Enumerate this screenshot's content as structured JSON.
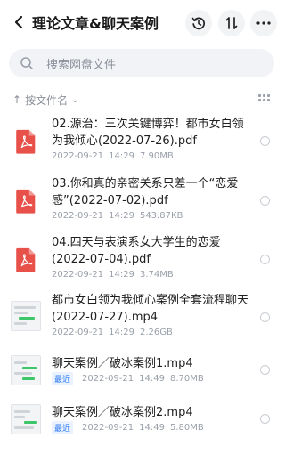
{
  "header": {
    "title": "理论文章&聊天案例",
    "back_icon": "chevron-left-icon",
    "history_icon": "history-icon",
    "sort_icon": "sort-arrows-icon",
    "more_icon": "more-horizontal-icon"
  },
  "search": {
    "placeholder": "搜索网盘文件",
    "icon": "search-icon"
  },
  "sort": {
    "label": "按文件名",
    "arrow": "↑",
    "chevron": "⌄"
  },
  "files": [
    {
      "name": "02.源治：三次关键博弈！都市女白领为我倾心(2022-07-26).pdf",
      "date": "2022-09-21",
      "time": "14:29",
      "size": "7.90MB",
      "type": "pdf"
    },
    {
      "name": "03.你和真的亲密关系只差一个“恋爱感”(2022-07-02).pdf",
      "date": "2022-09-21",
      "time": "14:29",
      "size": "543.87KB",
      "type": "pdf"
    },
    {
      "name": "04.四天与表演系女大学生的恋爱(2022-07-04).pdf",
      "date": "2022-09-21",
      "time": "14:29",
      "size": "3.74MB",
      "type": "pdf"
    },
    {
      "name": "都市女白领为我倾心案例全套流程聊天(2022-07-27).mp4",
      "date": "2022-09-21",
      "time": "14:29",
      "size": "2.26GB",
      "type": "mp4"
    },
    {
      "name": "聊天案例／破冰案例1.mp4",
      "badge": "最近",
      "date": "2022-09-21",
      "time": "14:49",
      "size": "8.70MB",
      "type": "mp4"
    },
    {
      "name": "聊天案例／破冰案例2.mp4",
      "badge": "最近",
      "date": "2022-09-21",
      "time": "14:49",
      "size": "5.80MB",
      "type": "mp4"
    }
  ],
  "colors": {
    "pdf_red": "#e8504a",
    "badge_blue": "#3b82f6",
    "thumb_green": "#3ec66a"
  }
}
